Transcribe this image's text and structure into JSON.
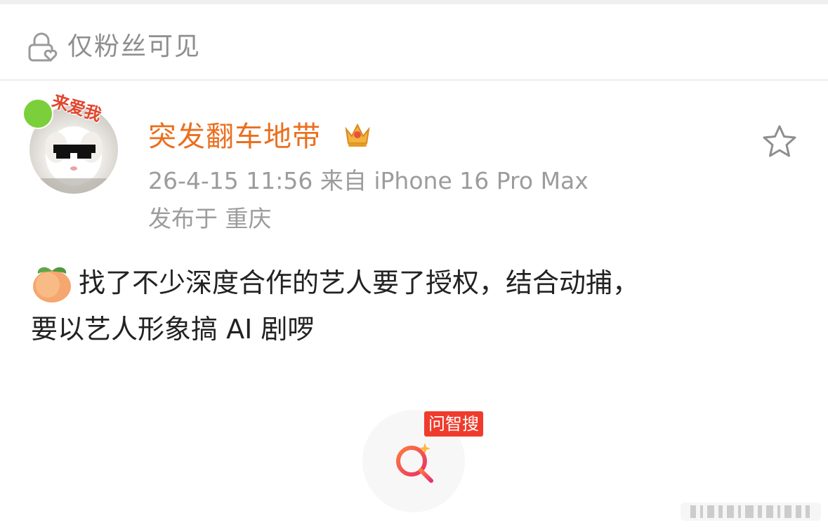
{
  "visibility": {
    "label": "仅粉丝可见"
  },
  "author": {
    "name": "突发翻车地带",
    "avatar_text": "来爱我"
  },
  "post": {
    "meta": "26-4-15 11:56  来自 iPhone 16 Pro Max",
    "location": "发布于 重庆",
    "content_line1": "找了不少深度合作的艺人要了授权，结合动捕，",
    "content_line2": "要以艺人形象搞 AI 剧啰"
  },
  "search_fab": {
    "badge": "问智搜"
  },
  "colors": {
    "username": "#eb6f1f",
    "meta": "#9c9c9c",
    "badge": "#ef3b2c",
    "search_icon": "#ef3b5a"
  },
  "icons": [
    "lock-heart-icon",
    "crown-icon",
    "star-icon",
    "peach-icon",
    "search-icon"
  ]
}
